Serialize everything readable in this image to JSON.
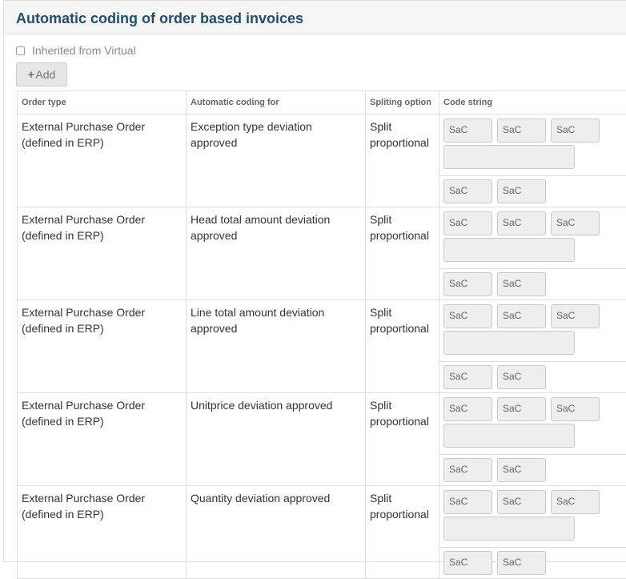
{
  "panel": {
    "title": "Automatic coding of order based invoices"
  },
  "inherited": {
    "label": "Inherited from Virtual",
    "checked": false
  },
  "add_button": {
    "label": "Add",
    "icon": "plus-icon"
  },
  "table": {
    "headers": [
      "Order type",
      "Automatic coding for",
      "Spliting option",
      "Code string"
    ],
    "rows": [
      {
        "order_type": "External Purchase Order (defined in ERP)",
        "coding_for": "Exception type deviation approved",
        "split": "Split proportional",
        "codes_top": [
          "SaC",
          "SaC",
          "SaC"
        ],
        "codes_bottom": [
          "SaC",
          "SaC"
        ]
      },
      {
        "order_type": "External Purchase Order (defined in ERP)",
        "coding_for": "Head total amount deviation approved",
        "split": "Split proportional",
        "codes_top": [
          "SaC",
          "SaC",
          "SaC"
        ],
        "codes_bottom": [
          "SaC",
          "SaC"
        ]
      },
      {
        "order_type": "External Purchase Order (defined in ERP)",
        "coding_for": "Line total amount deviation approved",
        "split": "Split proportional",
        "codes_top": [
          "SaC",
          "SaC",
          "SaC"
        ],
        "codes_bottom": [
          "SaC",
          "SaC"
        ]
      },
      {
        "order_type": "External Purchase Order (defined in ERP)",
        "coding_for": "Unitprice deviation approved",
        "split": "Split proportional",
        "codes_top": [
          "SaC",
          "SaC",
          "SaC"
        ],
        "codes_bottom": [
          "SaC",
          "SaC"
        ]
      },
      {
        "order_type": "External Purchase Order (defined in ERP)",
        "coding_for": "Quantity deviation approved",
        "split": "Split proportional",
        "codes_top": [
          "SaC",
          "SaC",
          "SaC"
        ],
        "codes_bottom": [
          "SaC",
          "SaC"
        ]
      }
    ]
  },
  "colors": {
    "title": "#1f4e6e",
    "border": "#dddddd",
    "field_bg": "#eeeeee"
  }
}
